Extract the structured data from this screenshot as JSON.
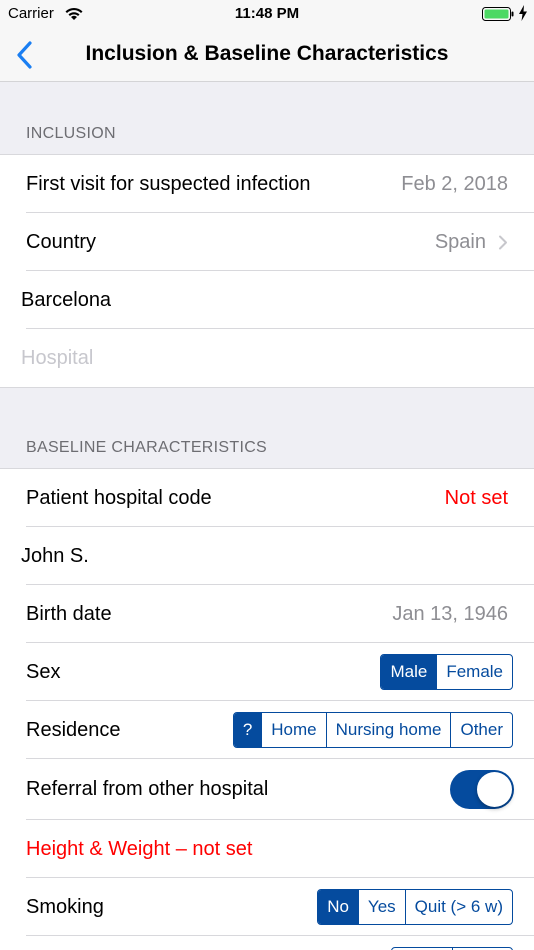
{
  "status_bar": {
    "carrier": "Carrier",
    "time": "11:48 PM"
  },
  "nav": {
    "title": "Inclusion & Baseline Characteristics"
  },
  "inclusion": {
    "header": "INCLUSION",
    "first_visit_label": "First visit for suspected infection",
    "first_visit_value": "Feb 2, 2018",
    "country_label": "Country",
    "country_value": "Spain",
    "city_value": "Barcelona",
    "hospital_placeholder": "Hospital"
  },
  "baseline": {
    "header": "BASELINE CHARACTERISTICS",
    "patient_code_label": "Patient hospital code",
    "patient_code_value": "Not set",
    "patient_name_value": "John S.",
    "birth_date_label": "Birth date",
    "birth_date_value": "Jan 13, 1946",
    "sex_label": "Sex",
    "sex_options": [
      "Male",
      "Female"
    ],
    "sex_selected": "Male",
    "residence_label": "Residence",
    "residence_options": [
      "?",
      "Home",
      "Nursing home",
      "Other"
    ],
    "residence_selected": "?",
    "referral_label": "Referral from other hospital",
    "referral_on": true,
    "height_weight_label": "Height & Weight – not set",
    "smoking_label": "Smoking",
    "smoking_options": [
      "No",
      "Yes",
      "Quit (> 6 w)"
    ],
    "smoking_selected": "No"
  },
  "colors": {
    "accent": "#054b9e",
    "alert": "#ff0000",
    "back": "#1a7ef2"
  },
  "icons": {
    "back": "chevron-left-icon",
    "disclosure": "chevron-right-icon",
    "wifi": "wifi-icon",
    "battery": "battery-icon"
  }
}
